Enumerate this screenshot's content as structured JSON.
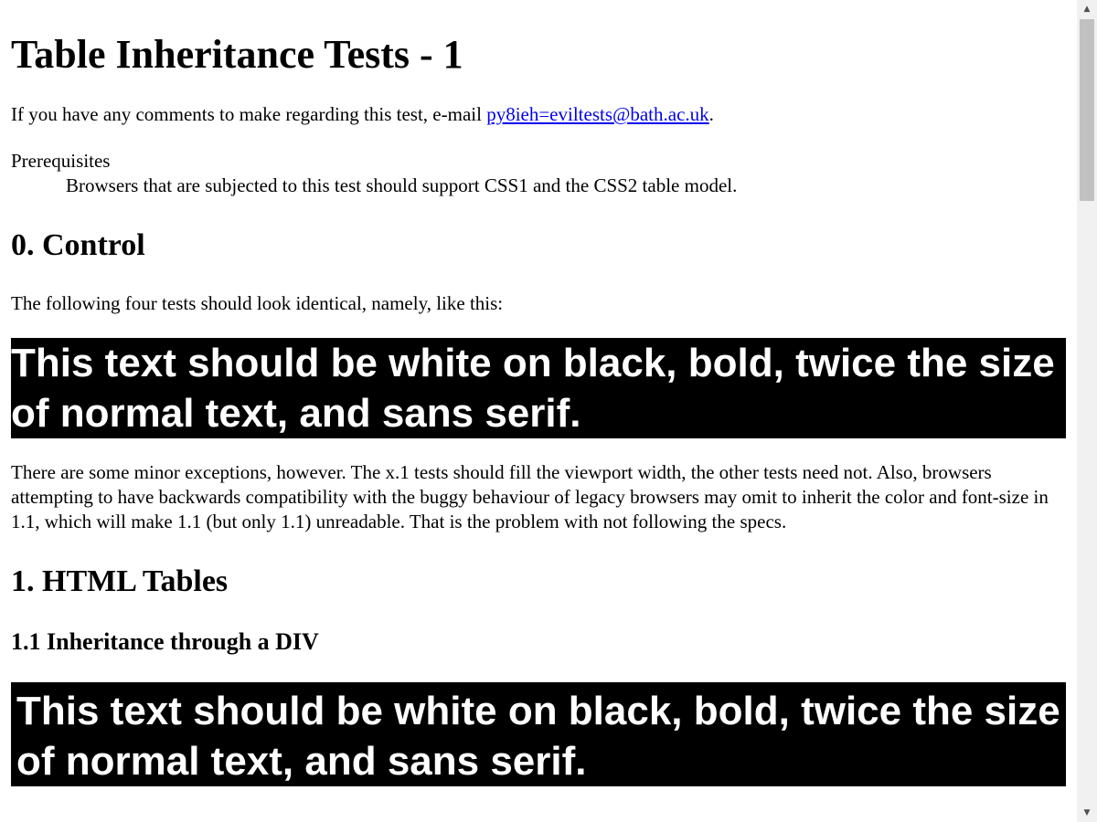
{
  "title": "Table Inheritance Tests - 1",
  "intro": {
    "prefix": "If you have any comments to make regarding this test, e-mail ",
    "email": "py8ieh=eviltests@bath.ac.uk",
    "suffix": "."
  },
  "prerequisites": {
    "term": "Prerequisites",
    "definition": "Browsers that are subjected to this test should support CSS1 and the CSS2 table model."
  },
  "section0": {
    "heading": "0. Control",
    "lead": "The following four tests should look identical, namely, like this:",
    "control_text": "This text should be white on black, bold, twice the size of normal text, and sans serif.",
    "exceptions": "There are some minor exceptions, however. The x.1 tests should fill the viewport width, the other tests need not. Also, browsers attempting to have backwards compatibility with the buggy behaviour of legacy browsers may omit to inherit the color and font-size in 1.1, which will make 1.1 (but only 1.1) unreadable. That is the problem with not following the specs."
  },
  "section1": {
    "heading": "1. HTML Tables",
    "sub1": {
      "heading": "1.1 Inheritance through a DIV",
      "test_text": "This text should be white on black, bold, twice the size of normal text, and sans serif."
    }
  },
  "scrollbar": {
    "up_icon": "▲",
    "down_icon": "▼"
  }
}
